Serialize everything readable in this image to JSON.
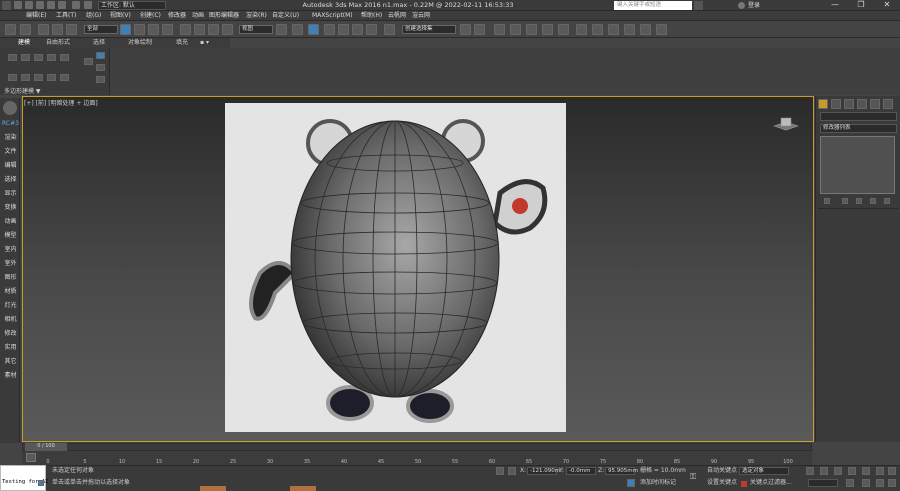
{
  "window": {
    "title": "Autodesk 3ds Max 2016    n1.max - 0.22M @ 2022-02-11 16:53:33",
    "workspace": "工作区: 默认",
    "search_placeholder": "键入关键字或短语",
    "login": "登录",
    "min": "—",
    "max": "❐",
    "close": "✕"
  },
  "menu": [
    "编辑(E)",
    "工具(T)",
    "组(G)",
    "视图(V)",
    "创建(C)",
    "修改器",
    "动画",
    "图形编辑器",
    "渲染(R)",
    "自定义(U)",
    "MAXScript(M)",
    "帮助(H)",
    "云帆网",
    "渲云网"
  ],
  "toolbar": {
    "selection_filter": "全部",
    "view_dropdown": "视图",
    "named_selection": "创建选择集"
  },
  "ribbon": {
    "tabs": [
      "建模",
      "自由形式",
      "选择",
      "对象绘制",
      "填充"
    ],
    "panel_label": "多边形建模 ▼"
  },
  "left_panel": [
    "RC#3",
    "渲染",
    "文件",
    "编辑",
    "选择",
    "显示",
    "变换",
    "动画",
    "模型",
    "室内",
    "室外",
    "图形",
    "材质",
    "灯光",
    "相机",
    "修改",
    "实用",
    "其它",
    "素材"
  ],
  "viewport": {
    "label": "[+] [前] [明暗处理 + 边面]"
  },
  "right_panel": {
    "modifier_list": "修改器列表"
  },
  "timeline": {
    "frame": "0 / 100",
    "ticks": [
      "0",
      "5",
      "10",
      "15",
      "20",
      "25",
      "30",
      "35",
      "40",
      "45",
      "50",
      "55",
      "60",
      "65",
      "70",
      "75",
      "80",
      "85",
      "90",
      "95",
      "100"
    ]
  },
  "status": {
    "maxscript_text": "Testing for AI",
    "selection": "未选定任何对象",
    "prompt": "单击或单击并拖动以选择对象",
    "x_label": "X:",
    "x_value": "-121.090m",
    "y_label": "Y:",
    "y_value": "-0.0mm",
    "z_label": "Z:",
    "z_value": "95.905mm",
    "grid": "栅格 = 10.0mm",
    "auto_key": "自动关键点",
    "selected": "选定对象",
    "add_time_tag": "添加时间标记",
    "set_key": "设置关键点",
    "key_filters": "关键点过滤器..."
  },
  "colors": {
    "viewport_border": "#c99b2b",
    "accent_blue": "#3f7fb6",
    "key_red": "#c0392b"
  }
}
